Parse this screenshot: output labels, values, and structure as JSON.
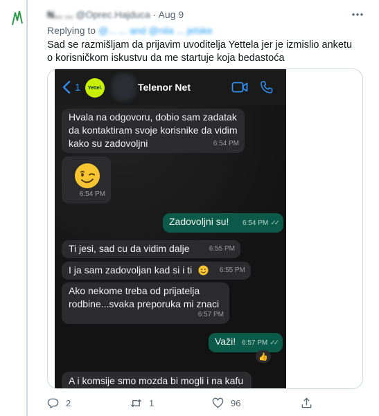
{
  "tweet": {
    "author_name": "N... ...",
    "author_handle": "@Oprec.Hajduca",
    "separator": "·",
    "date": "Aug 9",
    "replying_prefix": "Replying to",
    "replying_to": "@... ... and @nila ... jetske",
    "text": "Sad se razmišljam da prijavim uvoditelja Yettela jer je izmislio anketu o korisničkom iskustvu da me startuje koja bedastoća"
  },
  "chat": {
    "back_count": "1",
    "logo_text": "Yettel.",
    "contact_name": "Telenor Net",
    "messages": [
      {
        "direction": "in",
        "text": "Hvala na odgovoru, dobio sam zadatak da kontaktiram svoje korisnike da vidim kako su zadovoljni",
        "time": "6:54 PM"
      },
      {
        "direction": "in",
        "emoji": "winking-face",
        "time": "6:54 PM"
      },
      {
        "direction": "out",
        "text": "Zadovoljni su!",
        "time": "6:54 PM"
      },
      {
        "direction": "in",
        "text": "Ti jesi, sad cu da vidim dalje",
        "time": "6:55 PM"
      },
      {
        "direction": "in",
        "text": "I ja sam zadovoljan kad si i ti",
        "time": "6:55 PM"
      },
      {
        "direction": "in",
        "text": "Ako nekome treba od prijatelja rodbine...svaka preporuka mi znaci",
        "time": "6:57 PM"
      },
      {
        "direction": "out",
        "text": "Važi!",
        "time": "6:57 PM",
        "reaction": "👍"
      },
      {
        "direction": "in",
        "text": "A i komsije smo mozda bi mogli i na kafu"
      }
    ]
  },
  "actions": {
    "reply_count": "2",
    "retweet_count": "1",
    "like_count": "96"
  },
  "colors": {
    "accent": "#1d9bf0",
    "text_secondary": "#536471",
    "outgoing_bubble": "#0b5a4a",
    "incoming_bubble": "#2c2c2e",
    "ios_blue": "#2f8ff4"
  }
}
